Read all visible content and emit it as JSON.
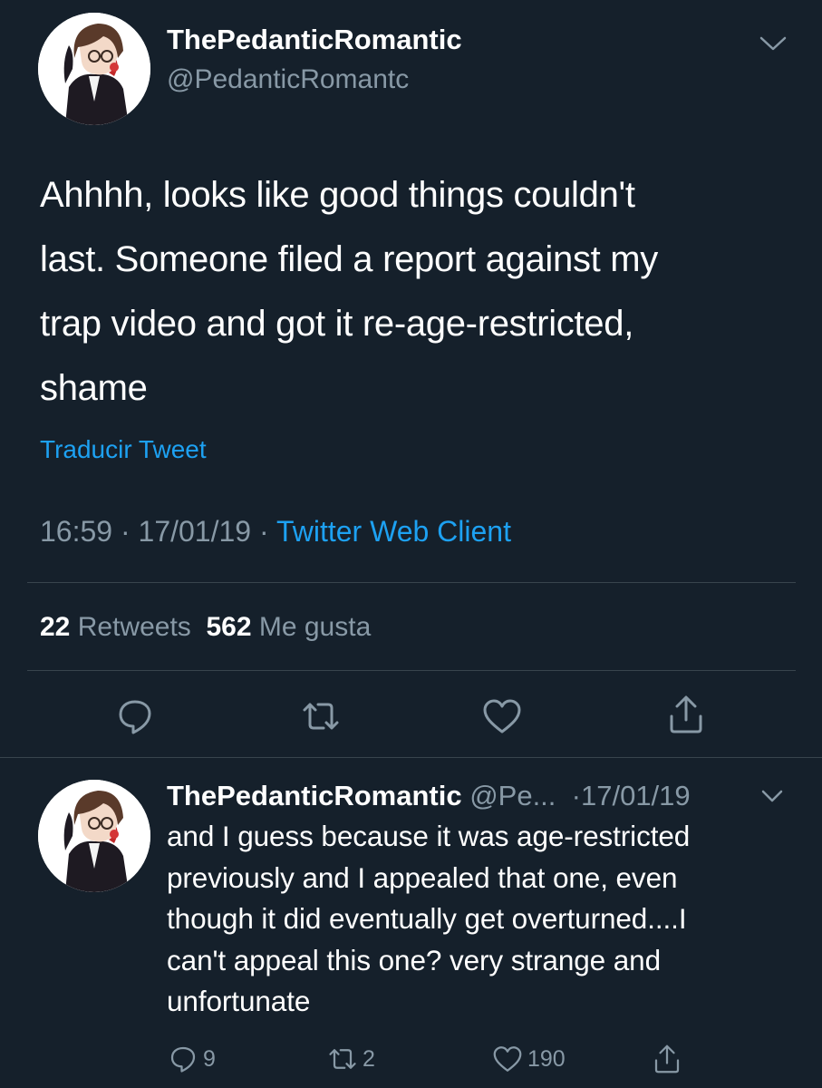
{
  "tweet": {
    "author_name": "ThePedanticRomantic",
    "author_handle": "@PedanticRomantc",
    "text_lines": [
      "Ahhhh, looks like good things couldn't",
      "last.  Someone filed a report against my",
      "trap video and got it re-age-restricted,",
      "shame"
    ],
    "translate_label": "Traducir Tweet",
    "time": "16:59",
    "date": "17/01/19",
    "separator": "·",
    "client": "Twitter Web Client",
    "retweets_count": "22",
    "retweets_label": "Retweets",
    "likes_count": "562",
    "likes_label": "Me gusta"
  },
  "reply": {
    "author_name": "ThePedanticRomantic",
    "author_handle": "@Pe...",
    "date": "·17/01/19",
    "text_lines": [
      "and I guess because it was age-restricted",
      "previously and I appealed that one, even",
      "though it did eventually get overturned....I",
      "can't appeal this one?  very strange and",
      "unfortunate"
    ],
    "reply_count": "9",
    "retweet_count": "2",
    "like_count": "190"
  },
  "icons": {
    "main_actions": [
      "reply-icon",
      "retweet-icon",
      "like-icon",
      "share-icon"
    ],
    "reply_actions": [
      "reply-icon",
      "retweet-icon",
      "like-icon",
      "share-icon"
    ],
    "menu": "chevron-down-icon"
  },
  "colors": {
    "background": "#15202b",
    "text": "#ffffff",
    "secondary": "#8899a6",
    "accent": "#1da1f2",
    "divider": "#38444d"
  }
}
